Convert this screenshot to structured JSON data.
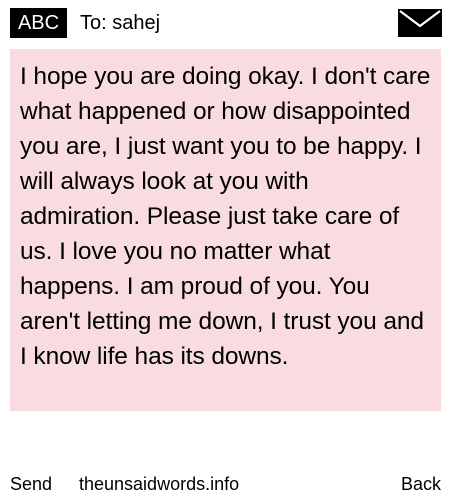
{
  "header": {
    "badge_label": "ABC",
    "to_label": "To:",
    "recipient": "sahej",
    "envelope_icon": "envelope-icon"
  },
  "message": {
    "body": "I hope you are doing okay. I don't care what happened or how disappointed you are, I just want you to be happy. I will always look at you with admiration. Please just take care of us. I love you no matter what happens. I am proud of you. You aren't letting me down, I trust you and I know life has its downs."
  },
  "footer": {
    "send_label": "Send",
    "site_label": "theunsaidwords.info",
    "back_label": "Back"
  },
  "colors": {
    "message_background": "#f9dce0",
    "badge_background": "#000000",
    "badge_text": "#ffffff"
  }
}
